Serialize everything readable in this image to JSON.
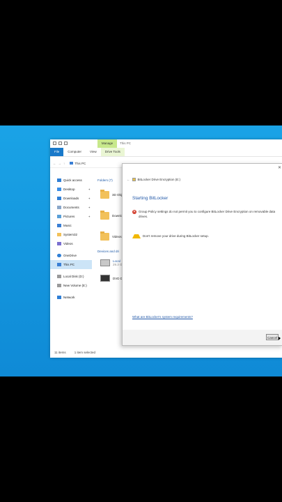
{
  "explorer": {
    "title": "This PC",
    "manage_tab": "Manage",
    "ribbon": [
      "File",
      "Computer",
      "View",
      "Drive Tools"
    ],
    "address": "This PC",
    "sidebar": [
      {
        "label": "Quick access",
        "pin": false
      },
      {
        "label": "Desktop",
        "pin": true
      },
      {
        "label": "Downloads",
        "pin": true
      },
      {
        "label": "Documents",
        "pin": true
      },
      {
        "label": "Pictures",
        "pin": true
      },
      {
        "label": "Music",
        "pin": false
      },
      {
        "label": "System32",
        "pin": false
      },
      {
        "label": "Videos",
        "pin": false
      },
      {
        "label": "OneDrive",
        "pin": false
      },
      {
        "label": "This PC",
        "pin": false,
        "selected": true
      },
      {
        "label": "Local Disk (D:)",
        "pin": false
      },
      {
        "label": "New Volume (E:)",
        "pin": false
      },
      {
        "label": "Network",
        "pin": false
      }
    ],
    "folders_header": "Folders (7)",
    "folders": [
      "3D Obje",
      "Downlo",
      "Videos"
    ],
    "devices_header": "Devices and dri",
    "drives": [
      {
        "name": "Local",
        "sub": "29.3 GB"
      },
      {
        "name": "DVD Dri",
        "sub": ""
      }
    ],
    "status": {
      "items": "11 items",
      "selected": "1 item selected"
    }
  },
  "dialog": {
    "close_glyph": "✕",
    "header": "BitLocker Drive Encryption (E:)",
    "title": "Starting BitLocker",
    "error_message": "Group Policy settings do not permit you to configure BitLocker Drive Encryption on removable data drives.",
    "warning_message": "Don't remove your drive during BitLocker setup.",
    "link": "What are BitLocker's system requirements?",
    "cancel_label": "Cancel"
  }
}
